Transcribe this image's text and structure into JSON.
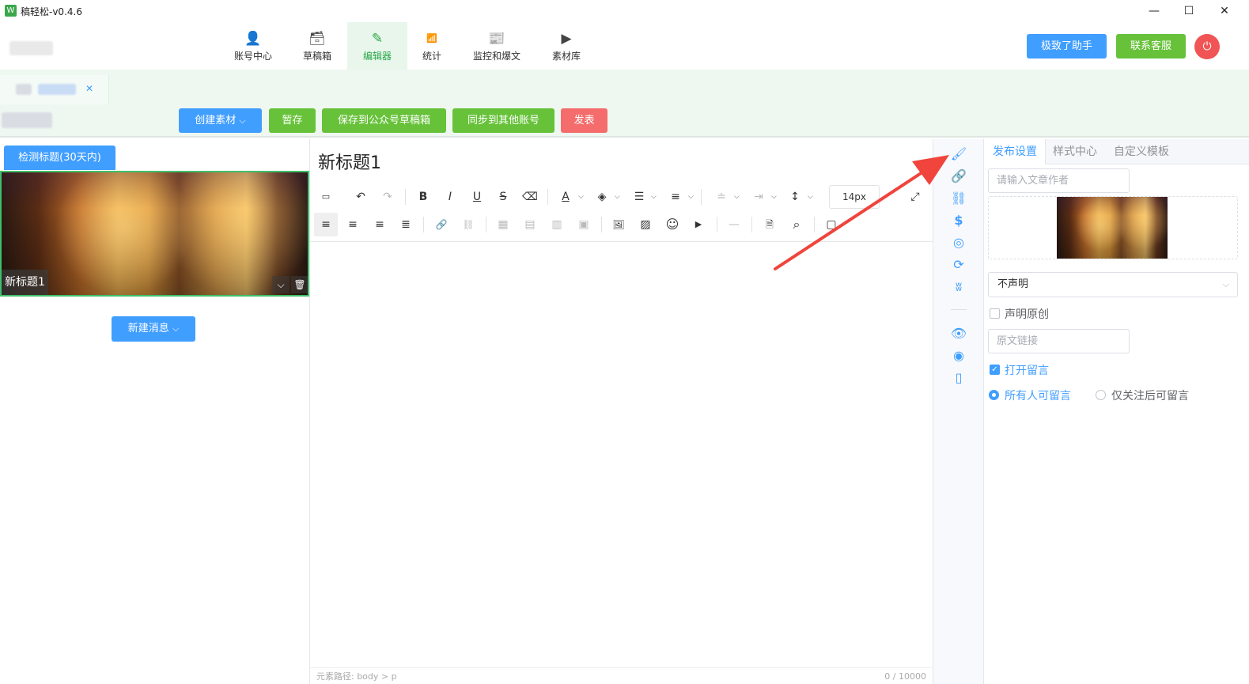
{
  "window": {
    "title": "稿轻松-v0.4.6",
    "logo_glyph": "W",
    "minimize_glyph": "—",
    "maximize_glyph": "☐",
    "close_glyph": "✕"
  },
  "nav": {
    "items": [
      {
        "label": "账号中心",
        "icon": "user-account-icon",
        "glyph": "👤"
      },
      {
        "label": "草稿箱",
        "icon": "inbox-tray-icon",
        "glyph": "🗃"
      },
      {
        "label": "编辑器",
        "icon": "pencil-icon",
        "glyph": "✎"
      },
      {
        "label": "统计",
        "icon": "bar-chart-icon",
        "glyph": "📶"
      },
      {
        "label": "监控和爆文",
        "icon": "document-monitor-icon",
        "glyph": "📰"
      },
      {
        "label": "素材库",
        "icon": "media-library-icon",
        "glyph": "▶"
      }
    ],
    "assistant_label": "极致了助手",
    "support_label": "联系客服",
    "power_glyph": "⏻"
  },
  "tab": {
    "close_glyph": "✕"
  },
  "actions": {
    "create_material": "创建素材",
    "temp_save": "暂存",
    "save_to_drafts": "保存到公众号草稿箱",
    "sync_accounts": "同步到其他账号",
    "publish": "发表",
    "dropdown_glyph": "⌵"
  },
  "left": {
    "check_title_label": "检测标题(30天内)",
    "article_title": "新标题1",
    "collapse_glyph": "⌵",
    "delete_glyph": "🗑",
    "new_message_label": "新建消息"
  },
  "editor": {
    "title": "新标题1",
    "font_size": "14px",
    "status_path": "元素路径: body > p",
    "word_count": "0 / 10000",
    "toolbar_row1": [
      {
        "name": "source-code-icon",
        "glyph": "▭"
      },
      {
        "name": "undo-icon",
        "glyph": "↶"
      },
      {
        "name": "redo-icon",
        "glyph": "↷"
      },
      {
        "name": "bold-icon",
        "glyph": "B"
      },
      {
        "name": "italic-icon",
        "glyph": "I"
      },
      {
        "name": "underline-icon",
        "glyph": "U"
      },
      {
        "name": "strikethrough-icon",
        "glyph": "S"
      },
      {
        "name": "eraser-icon",
        "glyph": "⌫"
      },
      {
        "name": "font-color-icon",
        "glyph": "A"
      },
      {
        "name": "highlight-color-icon",
        "glyph": "◈"
      },
      {
        "name": "ordered-list-icon",
        "glyph": "☰"
      },
      {
        "name": "bullet-list-icon",
        "glyph": "≡"
      },
      {
        "name": "paragraph-spacing-icon",
        "glyph": "≐"
      },
      {
        "name": "indent-icon",
        "glyph": "⇥"
      },
      {
        "name": "line-height-icon",
        "glyph": "↕"
      },
      {
        "name": "fullscreen-icon",
        "glyph": "⤢"
      }
    ],
    "toolbar_row2": [
      {
        "name": "align-left-icon",
        "glyph": "≡"
      },
      {
        "name": "align-center-icon",
        "glyph": "≡"
      },
      {
        "name": "align-right-icon",
        "glyph": "≡"
      },
      {
        "name": "align-justify-icon",
        "glyph": "≣"
      },
      {
        "name": "link-icon",
        "glyph": "🔗"
      },
      {
        "name": "unlink-icon",
        "glyph": "⛓"
      },
      {
        "name": "table-icon",
        "glyph": "▦"
      },
      {
        "name": "table-row-icon",
        "glyph": "▤"
      },
      {
        "name": "table-col-icon",
        "glyph": "▥"
      },
      {
        "name": "table-merge-icon",
        "glyph": "▣"
      },
      {
        "name": "image-upload-icon",
        "glyph": "🖼"
      },
      {
        "name": "image-icon",
        "glyph": "▨"
      },
      {
        "name": "emoji-icon",
        "glyph": "☺"
      },
      {
        "name": "video-icon",
        "glyph": "▶"
      },
      {
        "name": "divider-icon",
        "glyph": "—"
      },
      {
        "name": "preview-doc-icon",
        "glyph": "🗎"
      },
      {
        "name": "find-replace-icon",
        "glyph": "⌕"
      },
      {
        "name": "template-icon",
        "glyph": "▢"
      }
    ]
  },
  "rail": {
    "items": [
      {
        "name": "format-brush-icon",
        "glyph": "🖌"
      },
      {
        "name": "link-icon",
        "glyph": "🔗"
      },
      {
        "name": "chain-link-icon",
        "glyph": "⛓"
      },
      {
        "name": "dollar-icon",
        "glyph": "$"
      },
      {
        "name": "circle-link-icon",
        "glyph": "◎"
      },
      {
        "name": "sync-icon",
        "glyph": "⟳"
      },
      {
        "name": "butterfly-icon",
        "glyph": "ʬ"
      },
      {
        "name": "eye-icon",
        "glyph": "👁"
      },
      {
        "name": "scan-eye-icon",
        "glyph": "◉"
      },
      {
        "name": "mobile-icon",
        "glyph": "▯"
      }
    ]
  },
  "right": {
    "tabs": [
      "发布设置",
      "样式中心",
      "自定义模板"
    ],
    "author_placeholder": "请输入文章作者",
    "declare_value": "不声明",
    "declare_original": "声明原创",
    "source_link_placeholder": "原文链接",
    "open_comments": "打开留言",
    "comment_all": "所有人可留言",
    "comment_followers": "仅关注后可留言",
    "select_caret": "⌵",
    "check_glyph": "✓"
  },
  "colors": {
    "primary": "#409eff",
    "success": "#67c23a",
    "danger": "#f56c6c",
    "arrow": "#f0443c"
  }
}
